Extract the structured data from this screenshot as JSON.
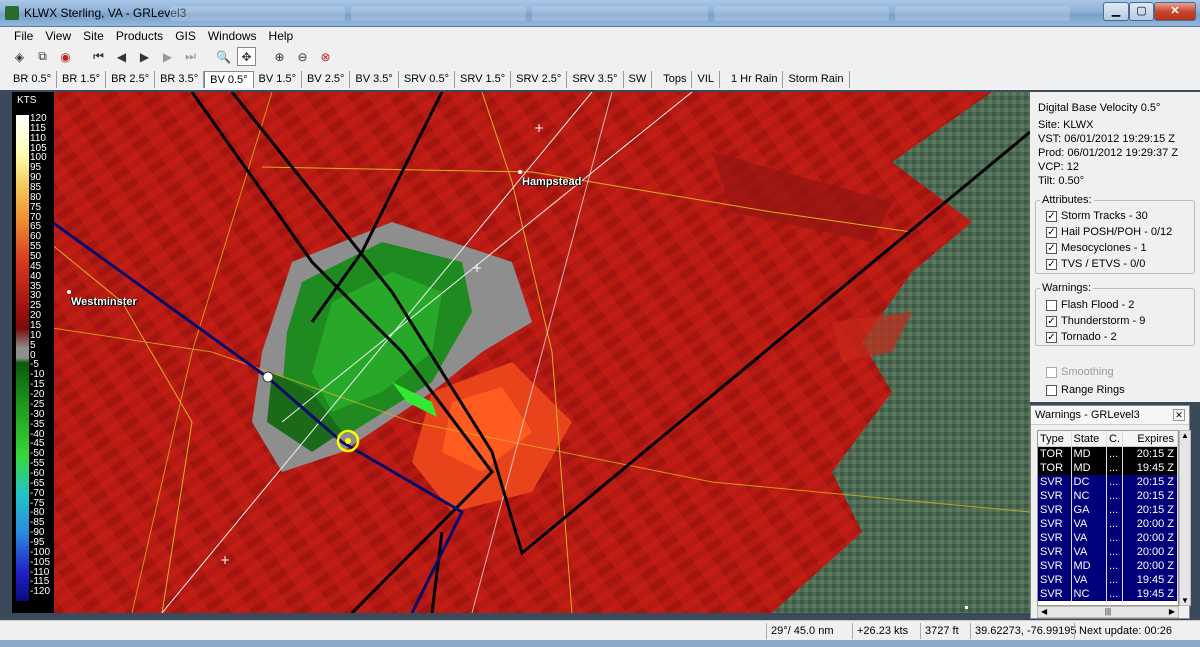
{
  "window": {
    "title": "KLWX Sterling, VA - GRLevel3",
    "min_icon": "minimize-icon",
    "max_icon": "maximize-icon",
    "close_label": "✕"
  },
  "menu": [
    {
      "label": "File"
    },
    {
      "label": "View"
    },
    {
      "label": "Site"
    },
    {
      "label": "Products"
    },
    {
      "label": "GIS"
    },
    {
      "label": "Windows"
    },
    {
      "label": "Help"
    }
  ],
  "toolbar": {
    "icons": [
      "layers-icon",
      "copy-icon",
      "radar-dish-icon",
      "first-frame-icon",
      "previous-frame-icon",
      "play-icon",
      "next-frame-icon",
      "last-frame-icon",
      "zoom-icon",
      "pan-icon",
      "zoom-in-icon",
      "zoom-out-icon",
      "zoom-reset-icon"
    ]
  },
  "product_tabs": [
    {
      "label": "BR 0.5°"
    },
    {
      "label": "BR 1.5°"
    },
    {
      "label": "BR 2.5°"
    },
    {
      "label": "BR 3.5°"
    },
    {
      "label": "BV 0.5°",
      "active": true
    },
    {
      "label": "BV 1.5°"
    },
    {
      "label": "BV 2.5°"
    },
    {
      "label": "BV 3.5°"
    },
    {
      "label": "SRV 0.5°"
    },
    {
      "label": "SRV 1.5°"
    },
    {
      "label": "SRV 2.5°"
    },
    {
      "label": "SRV 3.5°"
    },
    {
      "label": "SW"
    },
    {
      "label": "Tops"
    },
    {
      "label": "VIL"
    },
    {
      "label": "1 Hr Rain"
    },
    {
      "label": "Storm Rain"
    }
  ],
  "legend": {
    "unit": "KTS",
    "ticks": [
      "120",
      "115",
      "110",
      "105",
      "100",
      "95",
      "90",
      "85",
      "80",
      "75",
      "70",
      "65",
      "60",
      "55",
      "50",
      "45",
      "40",
      "35",
      "30",
      "25",
      "20",
      "15",
      "10",
      "5",
      "0",
      "-5",
      "-10",
      "-15",
      "-20",
      "-25",
      "-30",
      "-35",
      "-40",
      "-45",
      "-50",
      "-55",
      "-60",
      "-65",
      "-70",
      "-75",
      "-80",
      "-85",
      "-90",
      "-95",
      "-100",
      "-105",
      "-110",
      "-115",
      "-120"
    ]
  },
  "map": {
    "cities": [
      {
        "name": "Hampstead"
      },
      {
        "name": "Westminster"
      }
    ]
  },
  "info": {
    "product": "Digital Base Velocity 0.5°",
    "site": "Site:  KLWX",
    "vst": "VST:  06/01/2012  19:29:15 Z",
    "prod": "Prod:  06/01/2012  19:29:37 Z",
    "vcp": "VCP:  12",
    "tilt": "Tilt:  0.50°",
    "attributes_label": "Attributes:",
    "attributes": [
      {
        "label": "Storm Tracks - 30",
        "checked": true
      },
      {
        "label": "Hail POSH/POH - 0/12",
        "checked": true
      },
      {
        "label": "Mesocyclones - 1",
        "checked": true
      },
      {
        "label": "TVS / ETVS - 0/0",
        "checked": true
      }
    ],
    "warnings_label": "Warnings:",
    "warnings": [
      {
        "label": "Flash Flood - 2",
        "checked": false
      },
      {
        "label": "Thunderstorm - 9",
        "checked": true
      },
      {
        "label": "Tornado - 2",
        "checked": true
      }
    ],
    "smoothing": "Smoothing",
    "range_rings": "Range Rings"
  },
  "warnings_window": {
    "title": "Warnings - GRLevel3",
    "headers": [
      "Type",
      "State",
      "C.",
      "Expires"
    ],
    "rows": [
      {
        "type": "TOR",
        "state": "MD",
        "c": "...",
        "expires": "20:15 Z"
      },
      {
        "type": "TOR",
        "state": "MD",
        "c": "...",
        "expires": "19:45 Z"
      },
      {
        "type": "SVR",
        "state": "DC",
        "c": "...",
        "expires": "20:15 Z"
      },
      {
        "type": "SVR",
        "state": "NC",
        "c": "...",
        "expires": "20:15 Z"
      },
      {
        "type": "SVR",
        "state": "GA",
        "c": "...",
        "expires": "20:15 Z"
      },
      {
        "type": "SVR",
        "state": "VA",
        "c": "...",
        "expires": "20:00 Z"
      },
      {
        "type": "SVR",
        "state": "VA",
        "c": "...",
        "expires": "20:00 Z"
      },
      {
        "type": "SVR",
        "state": "VA",
        "c": "...",
        "expires": "20:00 Z"
      },
      {
        "type": "SVR",
        "state": "MD",
        "c": "...",
        "expires": "20:00 Z"
      },
      {
        "type": "SVR",
        "state": "VA",
        "c": "...",
        "expires": "19:45 Z"
      },
      {
        "type": "SVR",
        "state": "NC",
        "c": "...",
        "expires": "19:45 Z"
      }
    ]
  },
  "status": {
    "azimuth": "29°/ 45.0 nm",
    "velocity": "+26.23 kts",
    "height": "3727 ft",
    "coords": "39.62273, -76.99195",
    "next_update": "Next update: 00:26"
  }
}
